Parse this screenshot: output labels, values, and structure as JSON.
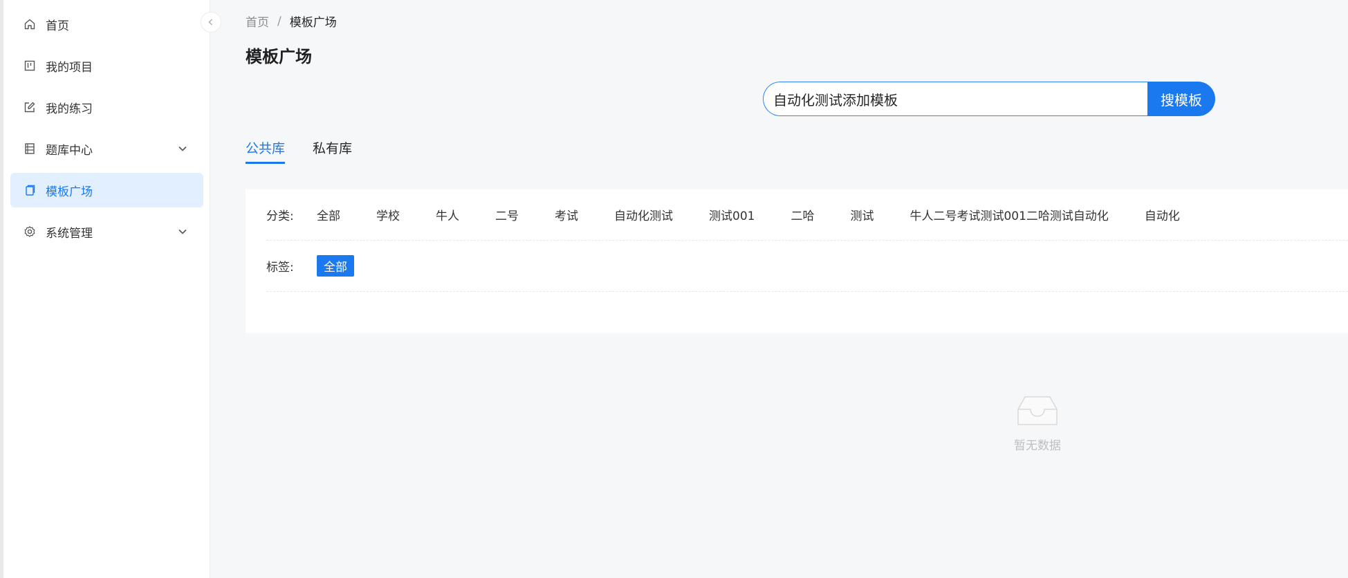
{
  "sidebar": {
    "items": [
      {
        "label": "首页",
        "icon": "home-icon"
      },
      {
        "label": "我的项目",
        "icon": "project-board-icon"
      },
      {
        "label": "我的练习",
        "icon": "edit-icon"
      },
      {
        "label": "题库中心",
        "icon": "question-bank-icon",
        "expandable": true
      },
      {
        "label": "模板广场",
        "icon": "template-icon",
        "active": true
      },
      {
        "label": "系统管理",
        "icon": "gear-icon",
        "expandable": true
      }
    ]
  },
  "breadcrumb": {
    "home": "首页",
    "separator": "/",
    "current": "模板广场"
  },
  "page": {
    "title": "模板广场"
  },
  "search": {
    "value": "自动化测试添加模板",
    "button": "搜模板"
  },
  "tabs": [
    {
      "label": "公共库",
      "active": true
    },
    {
      "label": "私有库",
      "active": false
    }
  ],
  "filters": {
    "category_label": "分类:",
    "categories": [
      "全部",
      "学校",
      "牛人",
      "二号",
      "考试",
      "自动化测试",
      "测试001",
      "二哈",
      "测试",
      "牛人二号考试测试001二哈测试自动化",
      "自动化"
    ],
    "tag_label": "标签:",
    "tags": [
      "全部"
    ]
  },
  "empty": {
    "text": "暂无数据"
  },
  "colors": {
    "accent": "#1b79f0",
    "active_bg": "#e1efff"
  }
}
